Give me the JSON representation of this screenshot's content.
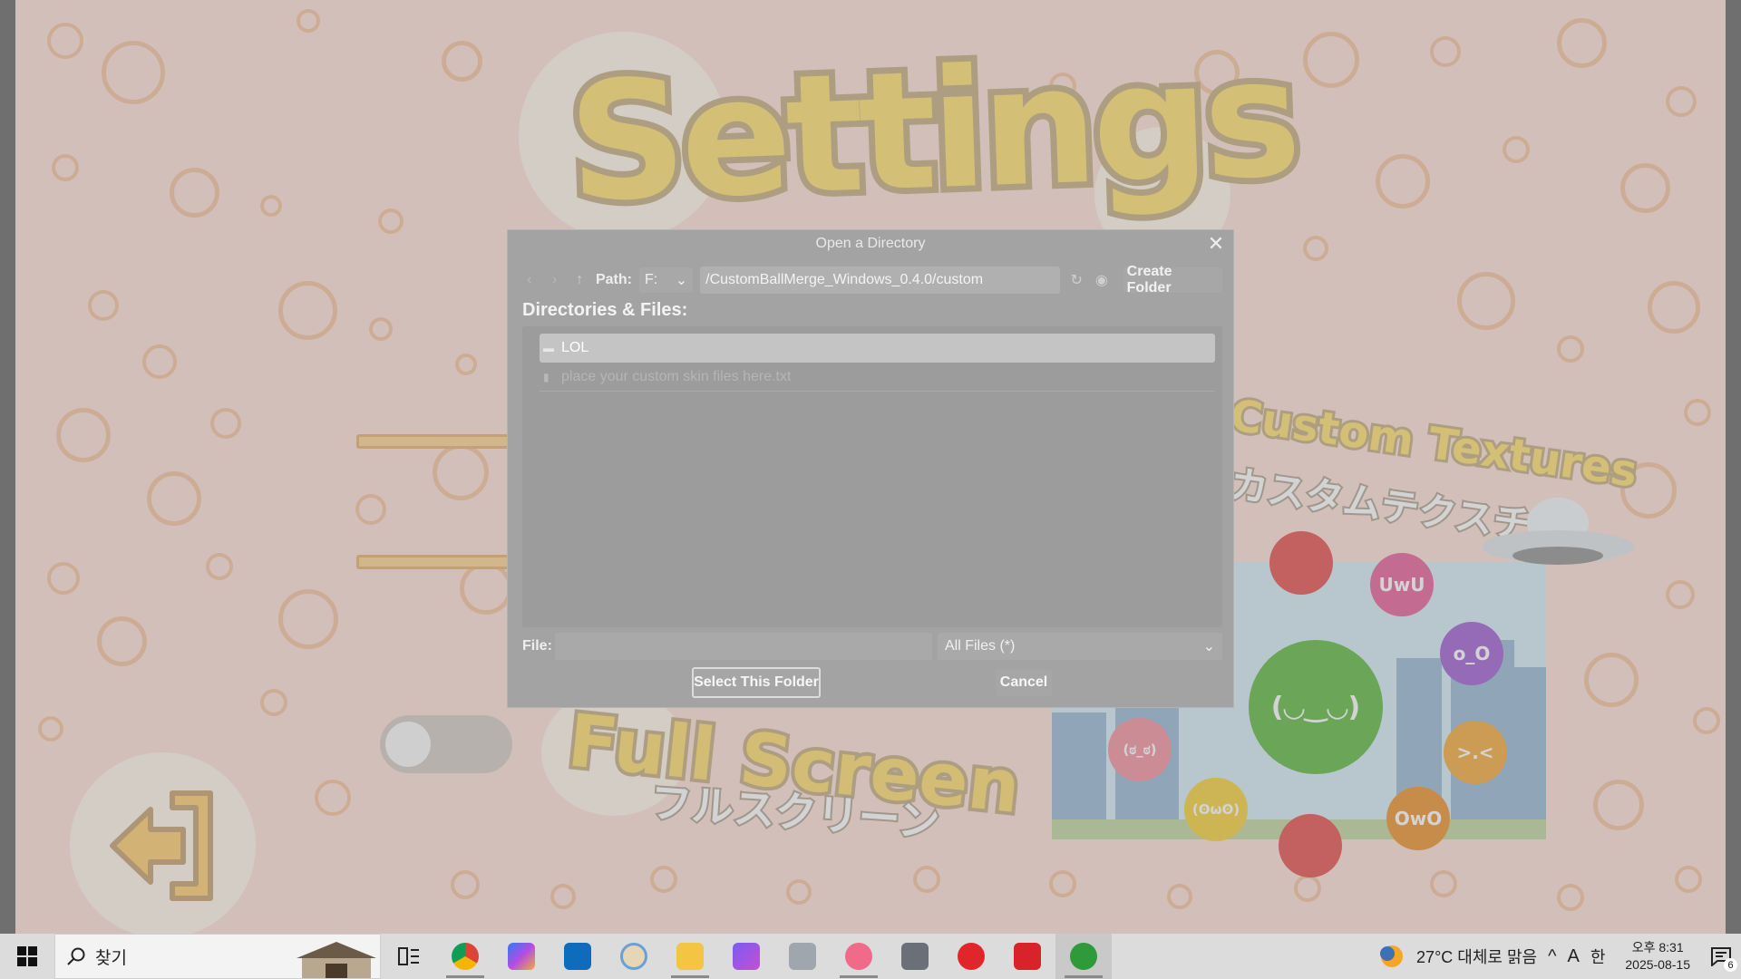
{
  "game": {
    "settings_title": "Settings",
    "custom_textures_title": "Custom Textures",
    "custom_textures_sub": "カスタムテクスチャ",
    "fullscreen_title": "Full Screen",
    "fullscreen_sub": "フルスクリーン",
    "preview_balls": [
      {
        "face": "UwU",
        "color": "#e86aa0"
      },
      {
        "face": "o_O",
        "color": "#a76ad8"
      },
      {
        "face": ">.<",
        "color": "#f5b14a"
      },
      {
        "face": "OwO",
        "color": "#f09a3c"
      },
      {
        "face": "(ʘωʘ)",
        "color": "#f7d54a"
      },
      {
        "face": "(ಠ_ಠ)",
        "color": "#f49aa8"
      },
      {
        "face": "(◡‿◡)",
        "color": "#6bbf4f"
      }
    ]
  },
  "dialog": {
    "title": "Open a Directory",
    "path_label": "Path:",
    "drive": "F:",
    "path_value": "/CustomBallMerge_Windows_0.4.0/custom",
    "create_folder_label": "Create Folder",
    "dir_files_label": "Directories & Files:",
    "items": [
      {
        "name": "LOL",
        "type": "folder",
        "selected": true
      },
      {
        "name": "place your custom skin files here.txt",
        "type": "file",
        "selected": false
      }
    ],
    "file_label": "File:",
    "file_value": "",
    "filter": "All Files (*)",
    "select_button": "Select This Folder",
    "cancel_button": "Cancel"
  },
  "taskbar": {
    "search_placeholder": "찾기",
    "weather": "27°C  대체로 맑음",
    "ime_lang": "A",
    "ime_mode": "한",
    "time": "오후 8:31",
    "date": "2025-08-15",
    "notification_count": "6"
  },
  "colors": {
    "game_bg": "#ffe3da",
    "bubble": "#f7c7a8",
    "dialog_bg": "#a3a3a3",
    "taskbar_bg": "#dcdcdc"
  }
}
